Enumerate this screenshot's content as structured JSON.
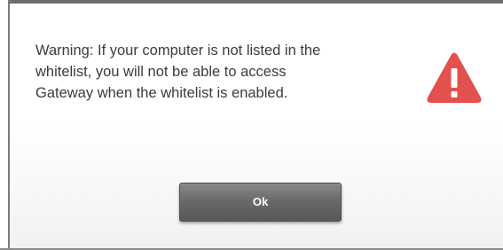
{
  "dialog": {
    "message_lines": [
      "Warning: If your computer is not listed in the",
      "whitelist, you will not be able to access",
      "Gateway when the whitelist is enabled."
    ],
    "icon": "warning-triangle-icon",
    "icon_color": "#e2514d",
    "ok_label": "Ok",
    "button_color": "#6a6a6a"
  }
}
